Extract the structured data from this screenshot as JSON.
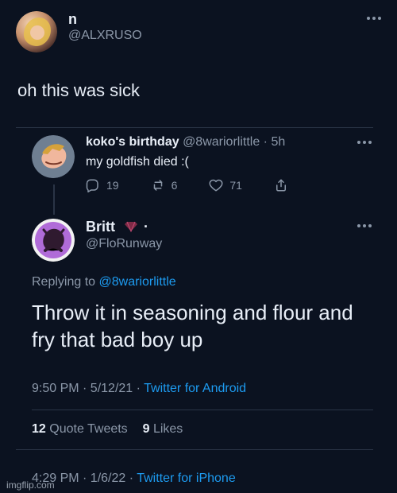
{
  "top": {
    "name": "n",
    "handle": "@ALXRUSO",
    "text": "oh this was sick"
  },
  "quoted": {
    "name": "koko's birthday",
    "handle": "@8wariorlittle",
    "time": "5h",
    "text": "my goldfish died :(",
    "actions": {
      "replies": "19",
      "retweets": "6",
      "likes": "71"
    }
  },
  "reply": {
    "name": "Britt",
    "name_suffix": "·",
    "handle": "@FloRunway",
    "replying_prefix": "Replying to",
    "replying_handle": "@8wariorlittle",
    "text": "Throw it in seasoning and flour and fry that bad boy up",
    "time": "9:50 PM · 5/12/21 ·",
    "client": "Twitter for Android",
    "stats": {
      "quote_count": "12",
      "quote_label": "Quote Tweets",
      "like_count": "9",
      "like_label": "Likes"
    }
  },
  "footer": {
    "time": "4:29 PM · 1/6/22 ·",
    "client": "Twitter for iPhone"
  },
  "watermark": "imgflip.com",
  "icons": {
    "more": "more-icon",
    "reply": "reply-icon",
    "retweet": "retweet-icon",
    "like": "heart-icon",
    "share": "share-icon"
  },
  "colors": {
    "link": "#1d9bf0",
    "muted": "#8b97a8",
    "background": "#0b1220"
  }
}
